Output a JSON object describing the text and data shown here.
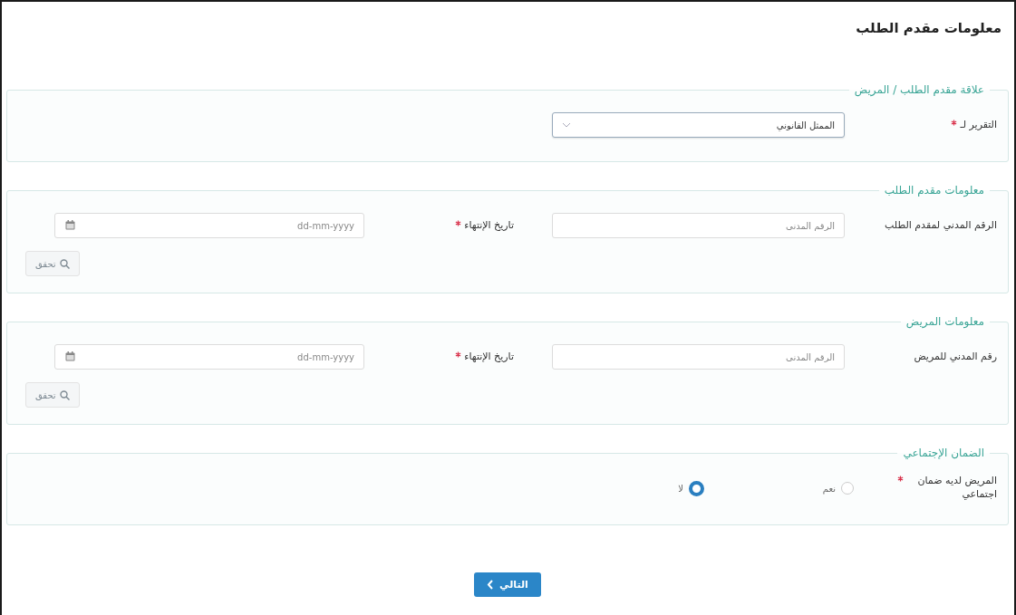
{
  "page_title": "معلومات مقدم الطلب",
  "sections": [
    {
      "legend": "علاقة مقدم الطلب / المريض",
      "fields": [
        {
          "kind": "select",
          "label": "التقرير لـ",
          "required": true,
          "value": "الممثل القانوني"
        }
      ]
    },
    {
      "legend": "معلومات مقدم الطلب",
      "fields": [
        {
          "kind": "text",
          "label": "الرقم المدني لمقدم الطلب",
          "required": false,
          "placeholder": "الرقم المدني"
        },
        {
          "kind": "date",
          "label": "تاريخ الإنتهاء",
          "required": true,
          "placeholder": "dd-mm-yyyy"
        }
      ],
      "verify_button": {
        "label": "تحقق",
        "disabled": true
      }
    },
    {
      "legend": "معلومات المريض",
      "fields": [
        {
          "kind": "text",
          "label": "رقم المدني للمريض",
          "required": false,
          "placeholder": "الرقم المدني"
        },
        {
          "kind": "date",
          "label": "تاريخ الإنتهاء",
          "required": true,
          "placeholder": "dd-mm-yyyy"
        }
      ],
      "verify_button": {
        "label": "تحقق",
        "disabled": true
      }
    },
    {
      "legend": "الضمان الإجتماعي",
      "fields": [
        {
          "kind": "radio",
          "label": "المريض لديه ضمان اجتماعي",
          "required": true,
          "options": [
            {
              "label": "نعم",
              "selected": false
            },
            {
              "label": "لا",
              "selected": true
            }
          ]
        }
      ]
    }
  ],
  "next_button": {
    "label": "التالي"
  }
}
